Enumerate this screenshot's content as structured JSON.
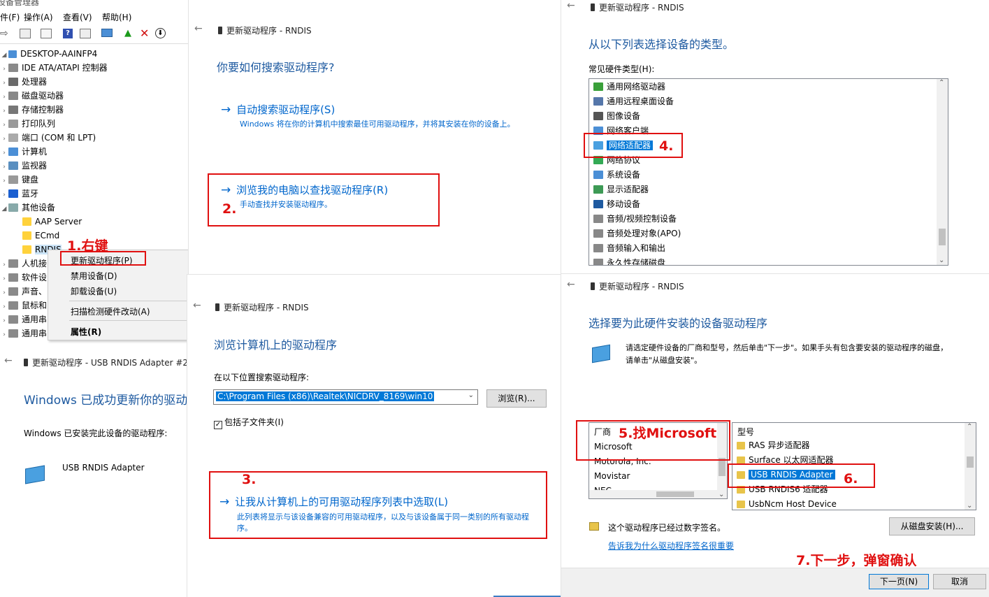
{
  "dm": {
    "title": "设备管理器",
    "menus": [
      "件(F)",
      "操作(A)",
      "查看(V)",
      "帮助(H)"
    ],
    "root": "DESKTOP-AAINFP4",
    "categories": [
      "IDE ATA/ATAPI 控制器",
      "处理器",
      "磁盘驱动器",
      "存储控制器",
      "打印队列",
      "端口 (COM 和 LPT)",
      "计算机",
      "监视器",
      "键盘",
      "蓝牙",
      "其他设备"
    ],
    "other_children": [
      "AAP Server",
      "ECmd",
      "RNDIS"
    ],
    "more_categories": [
      "人机接",
      "软件设",
      "声音、",
      "鼠标和",
      "通用串",
      "通用串"
    ]
  },
  "context_menu": {
    "items": [
      "更新驱动程序(P)",
      "禁用设备(D)",
      "卸载设备(U)",
      "扫描检测硬件改动(A)",
      "属性(R)"
    ]
  },
  "annotations": {
    "a1": "1.右键",
    "a2": "2.",
    "a3": "3.",
    "a4": "4.",
    "a5": "5.找Microsoft",
    "a6": "6.",
    "a7": "7.下一步，弹窗确认"
  },
  "panel2": {
    "title": "更新驱动程序 - RNDIS",
    "heading": "你要如何搜索驱动程序?",
    "opt1_title": "自动搜索驱动程序(S)",
    "opt1_desc": "Windows 将在你的计算机中搜索最佳可用驱动程序，并将其安装在你的设备上。",
    "opt2_title": "浏览我的电脑以查找驱动程序(R)",
    "opt2_desc": "手动查找并安装驱动程序。"
  },
  "panel3": {
    "title": "更新驱动程序 - RNDIS",
    "heading": "从以下列表选择设备的类型。",
    "list_label": "常见硬件类型(H):",
    "items": [
      "通用网络驱动器",
      "通用远程桌面设备",
      "图像设备",
      "网络客户端",
      "网络适配器",
      "网络协议",
      "系统设备",
      "显示适配器",
      "移动设备",
      "音频/视频控制设备",
      "音频处理对象(APO)",
      "音频输入和输出",
      "永久性存储磁盘"
    ]
  },
  "panel4": {
    "title": "更新驱动程序 - RNDIS",
    "heading": "浏览计算机上的驱动程序",
    "search_label": "在以下位置搜索驱动程序:",
    "path_value": "C:\\Program Files (x86)\\Realtek\\NICDRV_8169\\win10",
    "browse_btn": "浏览(R)...",
    "include_sub": "包括子文件夹(I)",
    "opt_title": "让我从计算机上的可用驱动程序列表中选取(L)",
    "opt_desc1": "此列表将显示与该设备兼容的可用驱动程序，以及与该设备属于同一类别的所有驱动程",
    "opt_desc2": "序。"
  },
  "panel5": {
    "title": "更新驱动程序 - RNDIS",
    "heading": "选择要为此硬件安装的设备驱动程序",
    "desc1": "请选定硬件设备的厂商和型号，然后单击\"下一步\"。如果手头有包含要安装的驱动程序的磁盘，",
    "desc2": "请单击\"从磁盘安装\"。",
    "mfr_header": "厂商",
    "mfrs": [
      "Microsoft",
      "Motorola, Inc.",
      "Movistar",
      "NEC"
    ],
    "model_header": "型号",
    "models": [
      "RAS 异步适配器",
      "Surface 以太网适配器",
      "USB RNDIS Adapter",
      "USB RNDIS6 适配器",
      "UsbNcm Host Device"
    ],
    "signed": "这个驱动程序已经过数字签名。",
    "signed_link": "告诉我为什么驱动程序签名很重要",
    "disk_btn": "从磁盘安装(H)...",
    "next_btn": "下一页(N)",
    "cancel_btn": "取消"
  },
  "panel6": {
    "title": "更新驱动程序 - USB RNDIS Adapter #2",
    "heading": "Windows 已成功更新你的驱动程",
    "subtext": "Windows 已安装完此设备的驱动程序:",
    "device": "USB RNDIS Adapter"
  }
}
